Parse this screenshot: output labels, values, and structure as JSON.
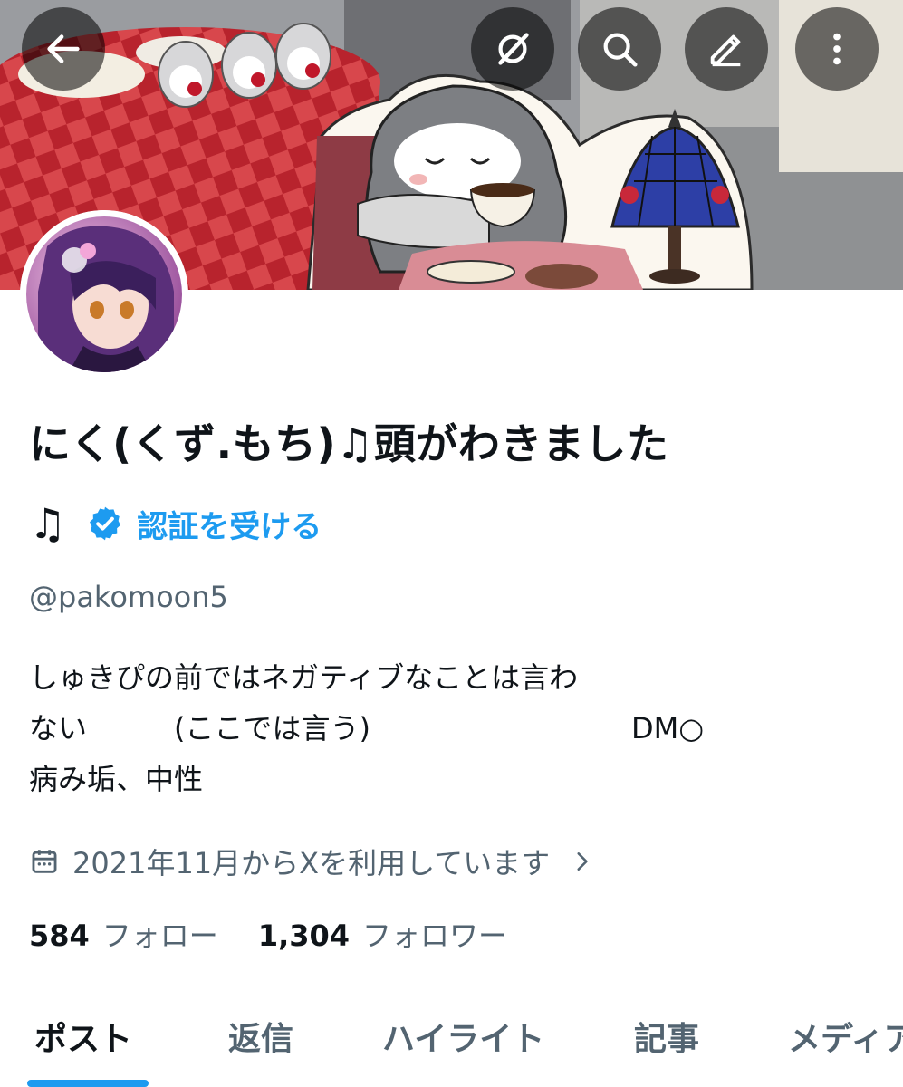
{
  "header": {
    "back_icon": "arrow-left-icon",
    "actions": [
      {
        "icon": "grok-icon"
      },
      {
        "icon": "search-icon"
      },
      {
        "icon": "compose-icon"
      },
      {
        "icon": "more-vertical-icon"
      }
    ]
  },
  "profile": {
    "display_name": "にく(くず.もち)♫頭がわきました",
    "name_suffix": "♫",
    "verify_label": "認証を受ける",
    "handle": "@pakomoon5",
    "bio_lines": [
      "しゅきぴの前ではネガティブなことは言わ",
      "ない　　　(ここでは言う)　　　　　　　　　DM○",
      "病み垢、中性"
    ],
    "joined": "2021年11月からXを利用しています",
    "following_count": "584",
    "following_label": "フォロー",
    "followers_count": "1,304",
    "followers_label": "フォロワー"
  },
  "tabs": [
    {
      "label": "ポスト",
      "active": true
    },
    {
      "label": "返信",
      "active": false
    },
    {
      "label": "ハイライト",
      "active": false
    },
    {
      "label": "記事",
      "active": false
    },
    {
      "label": "メディア",
      "active": false
    }
  ],
  "colors": {
    "accent": "#1d9bf0",
    "text": "#0f1419",
    "secondary_text": "#536471"
  }
}
